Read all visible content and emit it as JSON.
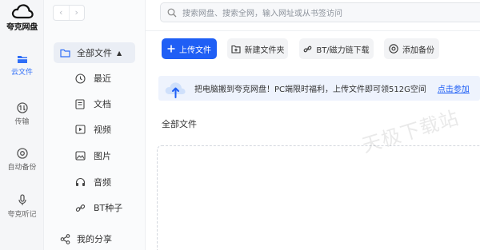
{
  "app": {
    "name": "夸克网盘"
  },
  "rail": {
    "items": [
      {
        "label": "云文件",
        "icon": "folder-icon",
        "active": true
      },
      {
        "label": "传输",
        "icon": "transfer-icon",
        "active": false
      },
      {
        "label": "自动备份",
        "icon": "backup-icon",
        "active": false
      },
      {
        "label": "夸克听记",
        "icon": "microphone-icon",
        "active": false
      }
    ]
  },
  "nav": {
    "back_icon": "chevron-left-icon",
    "forward_icon": "chevron-right-icon",
    "all_files": "全部文件",
    "items": [
      {
        "label": "最近",
        "icon": "clock-icon"
      },
      {
        "label": "文档",
        "icon": "document-icon"
      },
      {
        "label": "视频",
        "icon": "video-icon"
      },
      {
        "label": "图片",
        "icon": "image-icon"
      },
      {
        "label": "音频",
        "icon": "headphones-icon"
      },
      {
        "label": "BT种子",
        "icon": "link-icon"
      }
    ],
    "share": "我的分享"
  },
  "search": {
    "placeholder": "搜索网盘、搜索全网，输入网址或从书签访问"
  },
  "toolbar": {
    "upload": "上传文件",
    "new_folder": "新建文件夹",
    "bt_link": "BT/磁力链下载",
    "add_backup": "添加备份"
  },
  "banner": {
    "text": "把电脑搬到夸克网盘！PC端限时福利，上传文件即可领512G空间",
    "link": "点击参加"
  },
  "breadcrumb": "全部文件",
  "watermark": "天极下载站",
  "colors": {
    "accent": "#1f5ff5",
    "banner_bg": "#eef3fd",
    "rail_bg": "#f5f6f8"
  }
}
